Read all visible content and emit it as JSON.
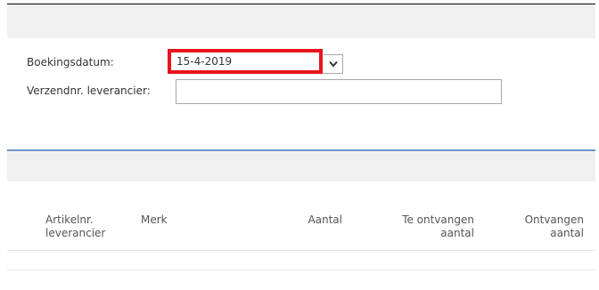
{
  "form": {
    "posting_date_label": "Boekingsdatum:",
    "posting_date_value": "15-4-2019",
    "vendor_shipment_label": "Verzendnr. leverancier:",
    "vendor_shipment_value": ""
  },
  "lines": {
    "columns": [
      {
        "line1": "Artikelnr.",
        "line2": "leverancier"
      },
      {
        "line1": "Merk",
        "line2": ""
      },
      {
        "line1": "Aantal",
        "line2": ""
      },
      {
        "line1": "Te ontvangen",
        "line2": "aantal"
      },
      {
        "line1": "Ontvangen",
        "line2": "aantal"
      }
    ]
  },
  "colors": {
    "highlight": "#e8141b",
    "accent_line": "#6d8fc7",
    "band": "#f0f0f0"
  }
}
